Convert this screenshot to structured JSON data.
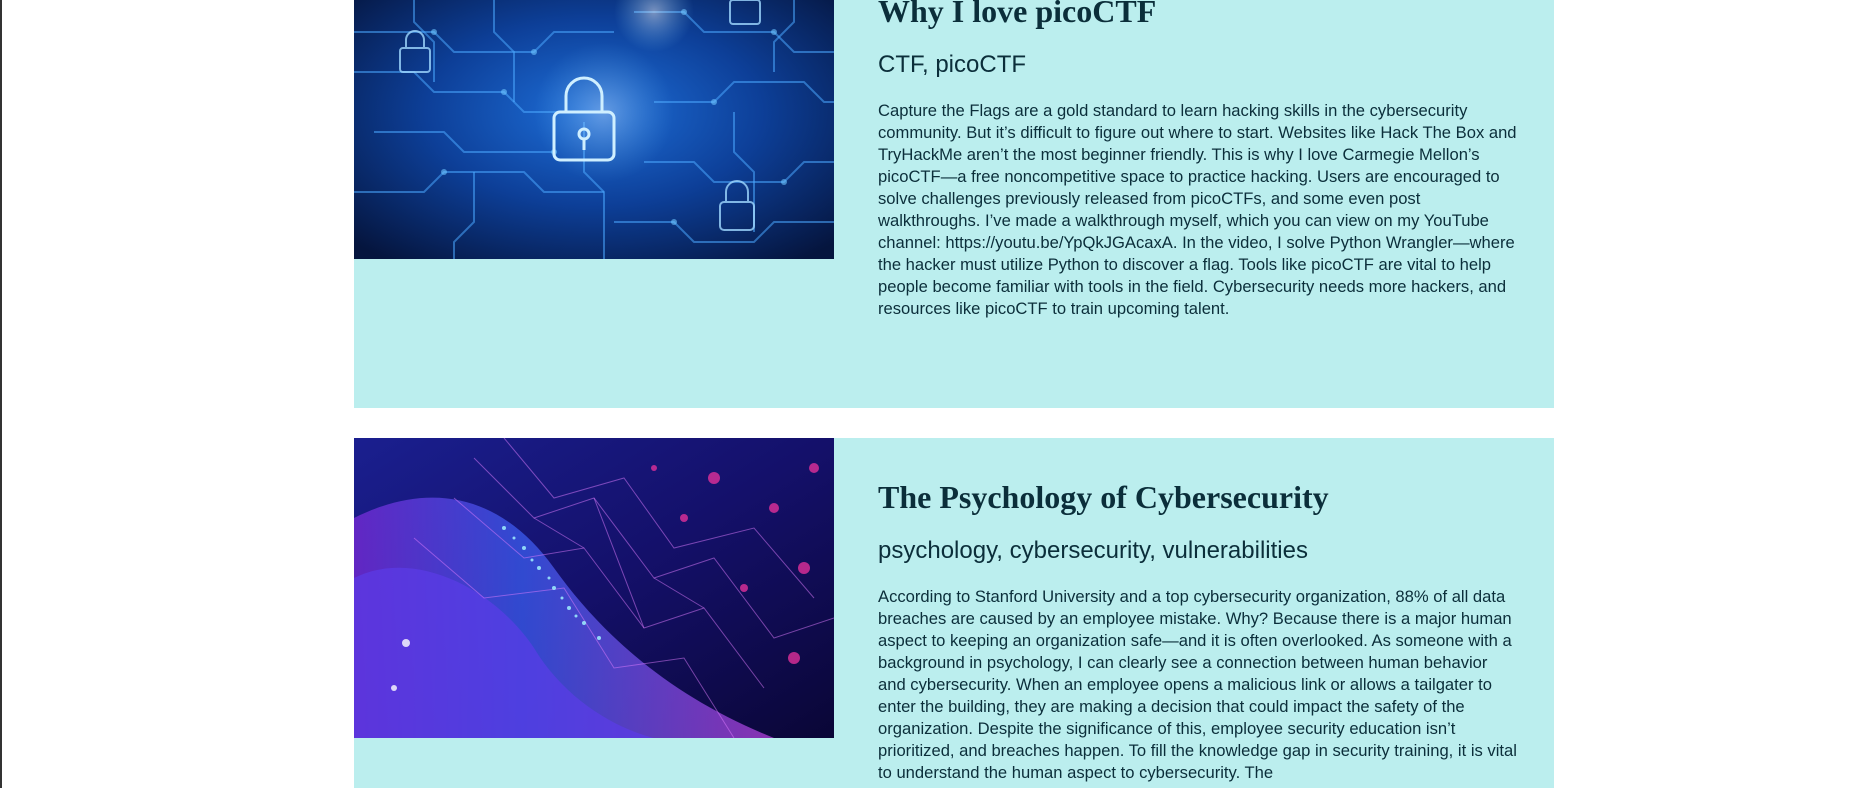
{
  "posts": [
    {
      "title": "Why I love picoCTF",
      "tags": "CTF, picoCTF",
      "body": "Capture the Flags are a gold standard to learn hacking skills in the cybersecurity community. But it’s difficult to figure out where to start. Websites like Hack The Box and TryHackMe aren’t the most beginner friendly. This is why I love Carmegie Mellon’s picoCTF—a free noncompetitive space to practice hacking. Users are encouraged to solve challenges previously released from picoCTFs, and some even post walkthroughs. I’ve made a walkthrough myself, which you can view on my YouTube channel: https://youtu.be/YpQkJGAcaxA. In the video, I solve Python Wrangler—where the hacker must utilize Python to discover a flag. Tools like picoCTF are vital to help people become familiar with tools in the field. Cybersecurity needs more hackers, and resources like picoCTF to train upcoming talent.",
      "image_icon": "circuit-padlock-image"
    },
    {
      "title": "The Psychology of Cybersecurity",
      "tags": "psychology, cybersecurity, vulnerabilities",
      "body": "According to Stanford University and a top cybersecurity organization, 88% of all data breaches are caused by an employee mistake. Why? Because there is a major human aspect to keeping an organization safe—and it is often overlooked. As someone with a background in psychology, I can clearly see a connection between human behavior and cybersecurity. When an employee opens a malicious link or allows a tailgater to enter the building, they are making a decision that could impact the safety of the organization. Despite the significance of this, employee security education isn’t prioritized, and breaches happen. To fill the knowledge gap in security training, it is vital to understand the human aspect to cybersecurity. The",
      "image_icon": "abstract-network-image"
    }
  ],
  "colors": {
    "card_background": "#bbeeee",
    "text": "#0b2e3a",
    "page_background": "#ffffff"
  }
}
